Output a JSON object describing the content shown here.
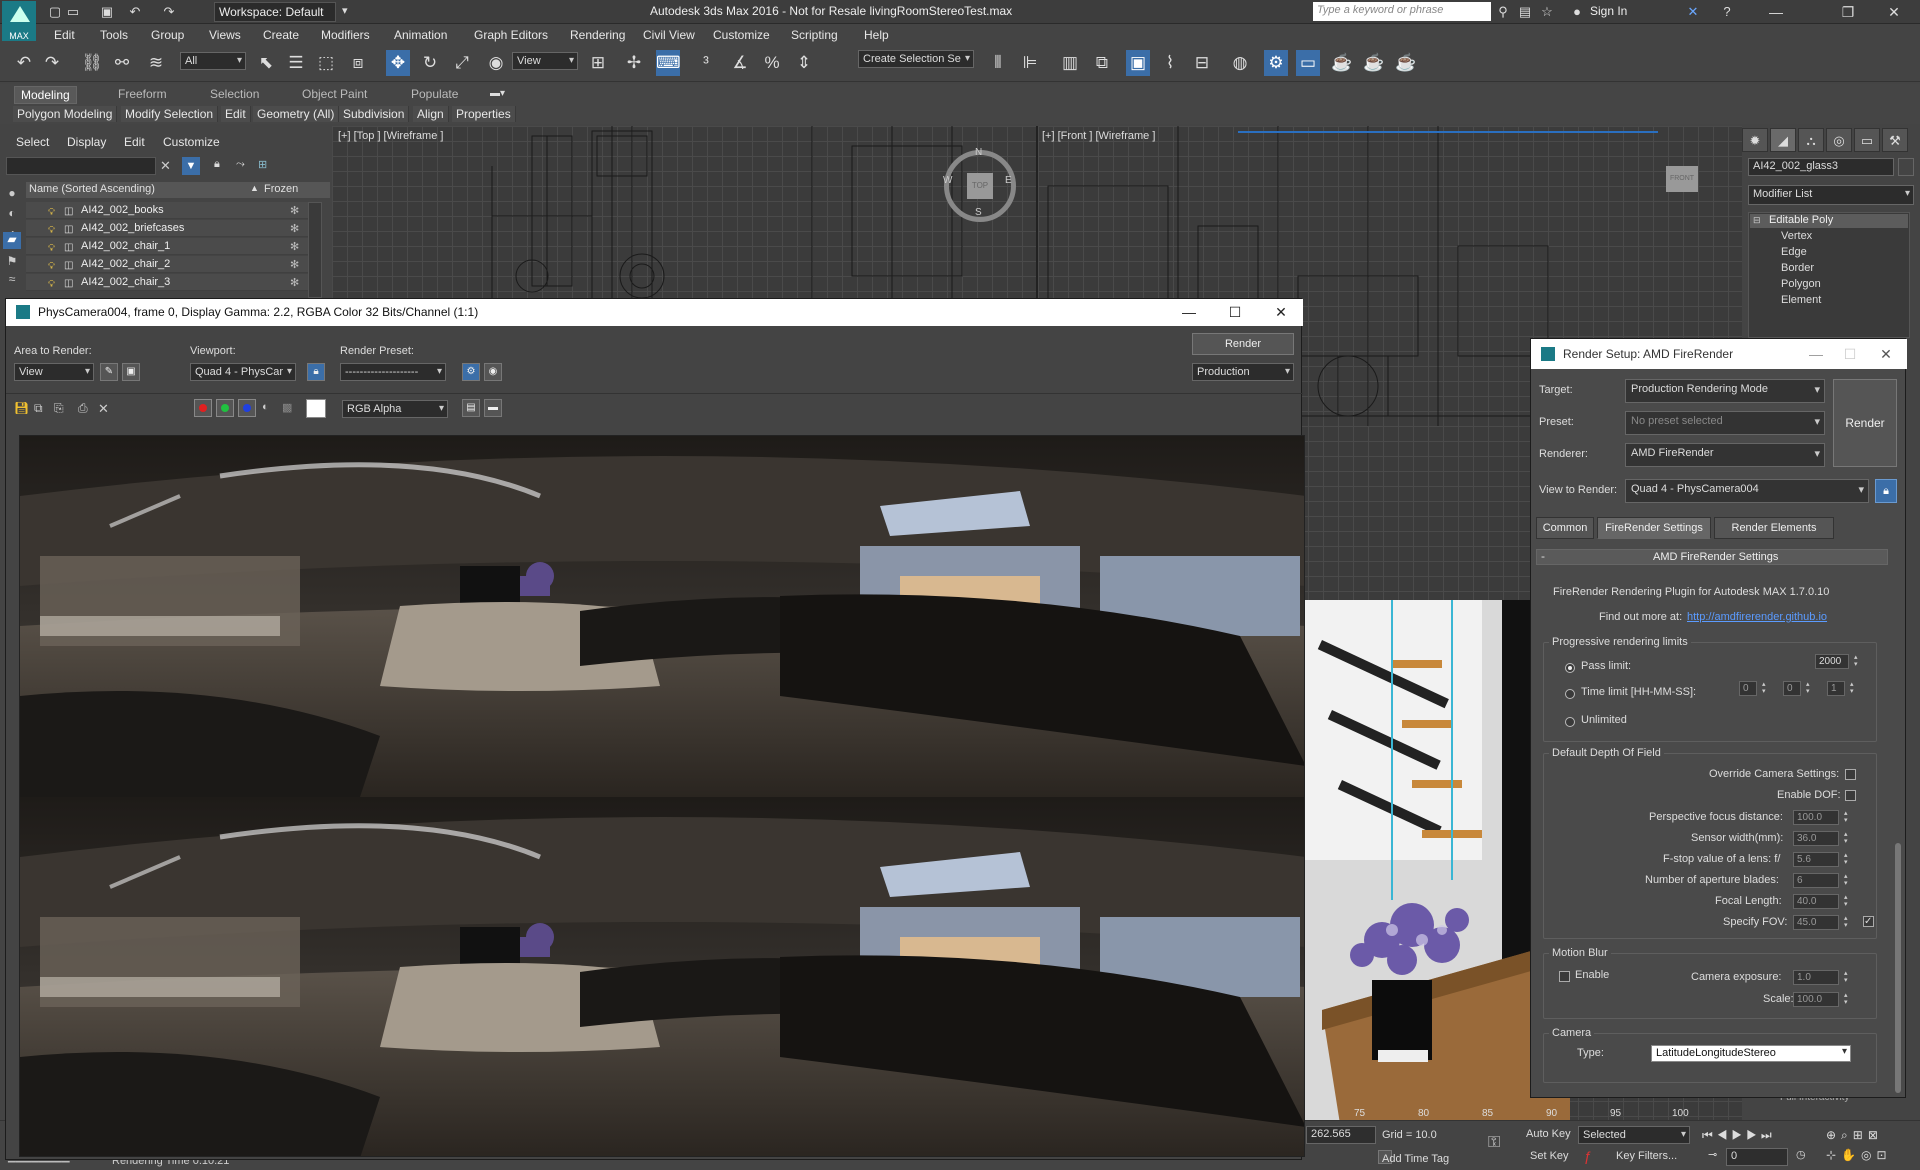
{
  "app": {
    "title": "Autodesk 3ds Max 2016 - Not for Resale   livingRoomStereoTest.max",
    "workspace": "Workspace: Default",
    "search_placeholder": "Type a keyword or phrase",
    "sign_in": "Sign In",
    "logo_text": "MAX"
  },
  "menu": [
    "Edit",
    "Tools",
    "Group",
    "Views",
    "Create",
    "Modifiers",
    "Animation",
    "Graph Editors",
    "Rendering",
    "Civil View",
    "Customize",
    "Scripting",
    "Help"
  ],
  "toolbar": {
    "filter": "All",
    "ref_coord": "View",
    "selection_set": "Create Selection Se"
  },
  "ribbon": {
    "tabs": [
      "Modeling",
      "Freeform",
      "Selection",
      "Object Paint",
      "Populate"
    ],
    "active_tab": "Modeling",
    "subtabs": [
      "Polygon Modeling",
      "Modify Selection",
      "Edit",
      "Geometry (All)",
      "Subdivision",
      "Align",
      "Properties"
    ]
  },
  "scene_explorer": {
    "tabs": [
      "Select",
      "Display",
      "Edit",
      "Customize"
    ],
    "col_name": "Name (Sorted Ascending)",
    "col_frozen": "Frozen",
    "rows": [
      "AI42_002_books",
      "AI42_002_briefcases",
      "AI42_002_chair_1",
      "AI42_002_chair_2",
      "AI42_002_chair_3"
    ]
  },
  "viewports": {
    "top_label": "[+] [Top ] [Wireframe ]",
    "front_label": "[+] [Front ] [Wireframe ]",
    "compass": {
      "n": "N",
      "s": "S",
      "e": "E",
      "w": "W",
      "cube": "TOP"
    },
    "front_cube": "FRONT"
  },
  "command_panel": {
    "object_name": "AI42_002_glass3",
    "modifier_list": "Modifier List",
    "stack": [
      "Editable Poly",
      "Vertex",
      "Edge",
      "Border",
      "Polygon",
      "Element"
    ],
    "bottom_item": "Full Interactivity"
  },
  "render_frame": {
    "title": "PhysCamera004, frame 0, Display Gamma: 2.2, RGBA Color 32 Bits/Channel (1:1)",
    "area_label": "Area to Render:",
    "area_value": "View",
    "viewport_label": "Viewport:",
    "viewport_value": "Quad 4 - PhysCar",
    "preset_label": "Render Preset:",
    "preset_value": "--------------------",
    "render_button": "Render",
    "mode_value": "Production",
    "channel_value": "RGB Alpha"
  },
  "render_setup": {
    "title": "Render Setup: AMD FireRender",
    "target_label": "Target:",
    "target_value": "Production Rendering Mode",
    "preset_label": "Preset:",
    "preset_value": "No preset selected",
    "renderer_label": "Renderer:",
    "renderer_value": "AMD FireRender",
    "view_label": "View to Render:",
    "view_value": "Quad 4 - PhysCamera004",
    "render_button": "Render",
    "tabs": [
      "Common",
      "FireRender Settings",
      "Render Elements"
    ],
    "active_tab": "FireRender Settings",
    "rollout_title": "AMD FireRender Settings",
    "plugin_text": "FireRender Rendering Plugin for Autodesk MAX 1.7.0.10",
    "find_more": "Find out more at:",
    "link": "http://amdfirerender.github.io",
    "progressive": {
      "title": "Progressive rendering limits",
      "pass_limit_label": "Pass limit:",
      "pass_limit_value": "2000",
      "time_limit_label": "Time limit [HH-MM-SS]:",
      "time_h": "0",
      "time_m": "0",
      "time_s": "1",
      "unlimited_label": "Unlimited"
    },
    "dof": {
      "title": "Default Depth Of Field",
      "override_label": "Override Camera Settings:",
      "enable_label": "Enable DOF:",
      "focus_label": "Perspective focus distance:",
      "focus_value": "100.0",
      "sensor_label": "Sensor width(mm):",
      "sensor_value": "36.0",
      "fstop_label": "F-stop value of a lens: f/",
      "fstop_value": "5.6",
      "blades_label": "Number of aperture blades:",
      "blades_value": "6",
      "focal_label": "Focal Length:",
      "focal_value": "40.0",
      "fov_label": "Specify FOV:",
      "fov_value": "45.0"
    },
    "motion_blur": {
      "title": "Motion Blur",
      "enable_label": "Enable",
      "exposure_label": "Camera exposure:",
      "exposure_value": "1.0",
      "scale_label": "Scale:",
      "scale_value": "100.0"
    },
    "camera": {
      "title": "Camera",
      "type_label": "Type:",
      "type_value": "LatitudeLongitudeStereo"
    }
  },
  "status": {
    "rendering_time": "Rendering Time  0:10:21",
    "coord_value": "262.565",
    "grid": "Grid = 10.0",
    "auto_key": "Auto Key",
    "set_key": "Set Key",
    "key_mode": "Selected",
    "key_filters": "Key Filters...",
    "add_time_tag": "Add Time Tag",
    "frame": "0",
    "ruler": [
      "75",
      "80",
      "85",
      "90",
      "95",
      "100"
    ]
  }
}
